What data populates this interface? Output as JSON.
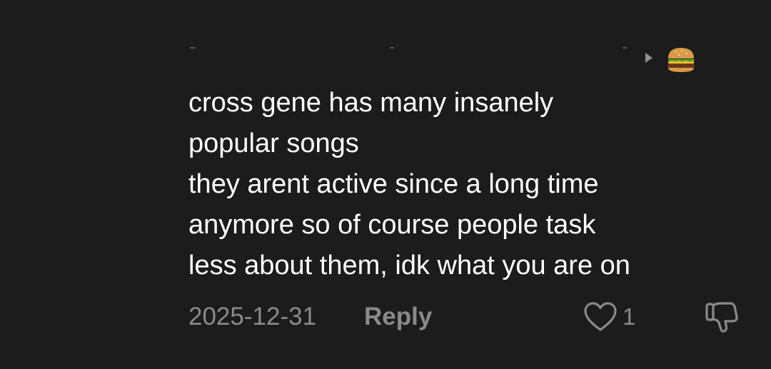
{
  "comment": {
    "author_icon": "hamburger-emoji",
    "reply_indicator_icon": "play-arrow-icon",
    "text_lines": [
      "cross gene has many insanely",
      "popular songs",
      "they arent active since a long time",
      "anymore so of course people task",
      "less about them, idk what you are on"
    ],
    "date": "2025-12-31",
    "reply_label": "Reply",
    "like_icon": "heart-outline-icon",
    "like_count": "1",
    "dislike_icon": "thumbs-down-icon"
  },
  "colors": {
    "background": "#1c1c1c",
    "text": "#ffffff",
    "muted": "#8a8a8a"
  }
}
